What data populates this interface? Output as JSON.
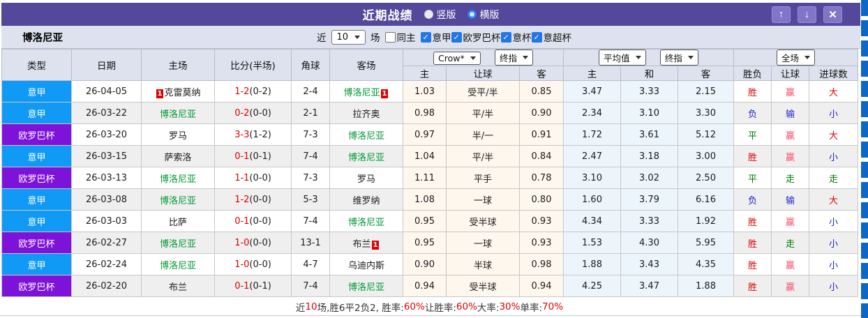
{
  "colors": {
    "titlebar_bg": "#54489B",
    "button_bg": "#8075C9",
    "serie_a": "#119AF5",
    "europa": "#7D12D9",
    "red": "#E00000",
    "pink": "#FF4A6B",
    "blue": "#2222CC",
    "green": "#007700",
    "tgreen": "#009933",
    "strip": "#0E67C5"
  },
  "titlebar": {
    "title": "近期战绩",
    "vertical_label": "竖版",
    "horizontal_label": "横版",
    "up_icon": "↑",
    "down_icon": "↓",
    "close_icon": "✕"
  },
  "filters": {
    "team": "博洛尼亚",
    "near_label": "近",
    "count": "10",
    "matches_label": "场",
    "same_home_label": "同主",
    "leagues": [
      {
        "label": "意甲",
        "checked": true
      },
      {
        "label": "欧罗巴杯",
        "checked": true
      },
      {
        "label": "意杯",
        "checked": true
      },
      {
        "label": "意超杯",
        "checked": true
      }
    ]
  },
  "header": {
    "main": [
      "类型",
      "日期",
      "主场",
      "比分(半场)",
      "角球",
      "客场"
    ],
    "sub": [
      "主",
      "让球",
      "客",
      "主",
      "和",
      "客",
      "胜负",
      "让球",
      "进球数"
    ],
    "selects": {
      "asia1": "Crow*",
      "asia2": "终指",
      "euro1": "平均值",
      "euro2": "终指",
      "scope": "全场"
    }
  },
  "rows": [
    {
      "league": "意甲",
      "lk": "serie_a",
      "date": "26-04-05",
      "home": {
        "pre": "1",
        "name": "克雷莫纳",
        "green": false,
        "post": ""
      },
      "score": "1-2",
      "half": "(0-2)",
      "corner": "2-4",
      "away": {
        "pre": "",
        "name": "博洛尼亚",
        "green": true,
        "post": "1"
      },
      "asia": [
        "1.03",
        "受平/半",
        "0.85"
      ],
      "euro": [
        "3.47",
        "3.33",
        "2.15"
      ],
      "wl": {
        "t": "胜",
        "c": "red"
      },
      "hc": {
        "t": "赢",
        "c": "pink"
      },
      "gl": {
        "t": "大",
        "c": "red"
      }
    },
    {
      "league": "意甲",
      "lk": "serie_a",
      "date": "26-03-22",
      "home": {
        "pre": "",
        "name": "博洛尼亚",
        "green": true,
        "post": ""
      },
      "score": "0-2",
      "half": "(0-0)",
      "corner": "2-1",
      "away": {
        "pre": "",
        "name": "拉齐奥",
        "green": false,
        "post": ""
      },
      "asia": [
        "0.98",
        "平/半",
        "0.90"
      ],
      "euro": [
        "2.34",
        "3.10",
        "3.30"
      ],
      "wl": {
        "t": "负",
        "c": "blue"
      },
      "hc": {
        "t": "输",
        "c": "blue"
      },
      "gl": {
        "t": "小",
        "c": "blue"
      }
    },
    {
      "league": "欧罗巴杯",
      "lk": "europa",
      "date": "26-03-20",
      "home": {
        "pre": "",
        "name": "罗马",
        "green": false,
        "post": ""
      },
      "score": "3-3",
      "half": "(1-2)",
      "corner": "7-3",
      "away": {
        "pre": "",
        "name": "博洛尼亚",
        "green": true,
        "post": ""
      },
      "asia": [
        "0.97",
        "半/一",
        "0.91"
      ],
      "euro": [
        "1.72",
        "3.61",
        "5.12"
      ],
      "wl": {
        "t": "平",
        "c": "green"
      },
      "hc": {
        "t": "赢",
        "c": "pink"
      },
      "gl": {
        "t": "大",
        "c": "red"
      }
    },
    {
      "league": "意甲",
      "lk": "serie_a",
      "date": "26-03-15",
      "home": {
        "pre": "",
        "name": "萨索洛",
        "green": false,
        "post": ""
      },
      "score": "0-1",
      "half": "(0-1)",
      "corner": "7-4",
      "away": {
        "pre": "",
        "name": "博洛尼亚",
        "green": true,
        "post": ""
      },
      "asia": [
        "1.04",
        "平/半",
        "0.84"
      ],
      "euro": [
        "2.47",
        "3.18",
        "3.00"
      ],
      "wl": {
        "t": "胜",
        "c": "red"
      },
      "hc": {
        "t": "赢",
        "c": "pink"
      },
      "gl": {
        "t": "小",
        "c": "blue"
      }
    },
    {
      "league": "欧罗巴杯",
      "lk": "europa",
      "date": "26-03-13",
      "home": {
        "pre": "",
        "name": "博洛尼亚",
        "green": true,
        "post": ""
      },
      "score": "1-1",
      "half": "(0-0)",
      "corner": "7-3",
      "away": {
        "pre": "",
        "name": "罗马",
        "green": false,
        "post": ""
      },
      "asia": [
        "1.11",
        "平手",
        "0.78"
      ],
      "euro": [
        "3.10",
        "3.02",
        "2.50"
      ],
      "wl": {
        "t": "平",
        "c": "green"
      },
      "hc": {
        "t": "走",
        "c": "green"
      },
      "gl": {
        "t": "走",
        "c": "green"
      }
    },
    {
      "league": "意甲",
      "lk": "serie_a",
      "date": "26-03-08",
      "home": {
        "pre": "",
        "name": "博洛尼亚",
        "green": true,
        "post": ""
      },
      "score": "1-2",
      "half": "(0-0)",
      "corner": "5-3",
      "away": {
        "pre": "",
        "name": "维罗纳",
        "green": false,
        "post": ""
      },
      "asia": [
        "1.08",
        "一球",
        "0.80"
      ],
      "euro": [
        "1.60",
        "3.79",
        "6.16"
      ],
      "wl": {
        "t": "负",
        "c": "blue"
      },
      "hc": {
        "t": "输",
        "c": "blue"
      },
      "gl": {
        "t": "大",
        "c": "red"
      }
    },
    {
      "league": "意甲",
      "lk": "serie_a",
      "date": "26-03-03",
      "home": {
        "pre": "",
        "name": "比萨",
        "green": false,
        "post": ""
      },
      "score": "0-1",
      "half": "(0-0)",
      "corner": "7-4",
      "away": {
        "pre": "",
        "name": "博洛尼亚",
        "green": true,
        "post": ""
      },
      "asia": [
        "0.95",
        "受半球",
        "0.93"
      ],
      "euro": [
        "4.34",
        "3.33",
        "1.92"
      ],
      "wl": {
        "t": "胜",
        "c": "red"
      },
      "hc": {
        "t": "赢",
        "c": "pink"
      },
      "gl": {
        "t": "小",
        "c": "blue"
      }
    },
    {
      "league": "欧罗巴杯",
      "lk": "europa",
      "date": "26-02-27",
      "home": {
        "pre": "",
        "name": "博洛尼亚",
        "green": true,
        "post": ""
      },
      "score": "1-0",
      "half": "(0-0)",
      "corner": "13-1",
      "away": {
        "pre": "",
        "name": "布兰",
        "green": false,
        "post": "1"
      },
      "asia": [
        "0.95",
        "一球",
        "0.93"
      ],
      "euro": [
        "1.53",
        "4.30",
        "5.95"
      ],
      "wl": {
        "t": "胜",
        "c": "red"
      },
      "hc": {
        "t": "走",
        "c": "green"
      },
      "gl": {
        "t": "小",
        "c": "blue"
      }
    },
    {
      "league": "意甲",
      "lk": "serie_a",
      "date": "26-02-24",
      "home": {
        "pre": "",
        "name": "博洛尼亚",
        "green": true,
        "post": ""
      },
      "score": "1-0",
      "half": "(0-0)",
      "corner": "4-7",
      "away": {
        "pre": "",
        "name": "乌迪内斯",
        "green": false,
        "post": ""
      },
      "asia": [
        "0.90",
        "半球",
        "0.98"
      ],
      "euro": [
        "1.88",
        "3.43",
        "4.35"
      ],
      "wl": {
        "t": "胜",
        "c": "red"
      },
      "hc": {
        "t": "赢",
        "c": "pink"
      },
      "gl": {
        "t": "小",
        "c": "blue"
      }
    },
    {
      "league": "欧罗巴杯",
      "lk": "europa",
      "date": "26-02-20",
      "home": {
        "pre": "",
        "name": "布兰",
        "green": false,
        "post": ""
      },
      "score": "0-1",
      "half": "(0-1)",
      "corner": "7-4",
      "away": {
        "pre": "",
        "name": "博洛尼亚",
        "green": true,
        "post": ""
      },
      "asia": [
        "0.94",
        "受半球",
        "0.94"
      ],
      "euro": [
        "4.25",
        "3.47",
        "1.88"
      ],
      "wl": {
        "t": "胜",
        "c": "red"
      },
      "hc": {
        "t": "赢",
        "c": "pink"
      },
      "gl": {
        "t": "小",
        "c": "blue"
      }
    }
  ],
  "footer": {
    "segments": [
      {
        "t": "近",
        "c": "dark"
      },
      {
        "t": "10",
        "c": "red"
      },
      {
        "t": "场,胜6平2负2, 胜率:",
        "c": "dark"
      },
      {
        "t": "60%",
        "c": "red"
      },
      {
        "t": " 让胜率:",
        "c": "dark"
      },
      {
        "t": "60%",
        "c": "red"
      },
      {
        "t": " 大率:",
        "c": "dark"
      },
      {
        "t": "30%",
        "c": "red"
      },
      {
        "t": " 单率:",
        "c": "dark"
      },
      {
        "t": "70%",
        "c": "red"
      }
    ]
  }
}
